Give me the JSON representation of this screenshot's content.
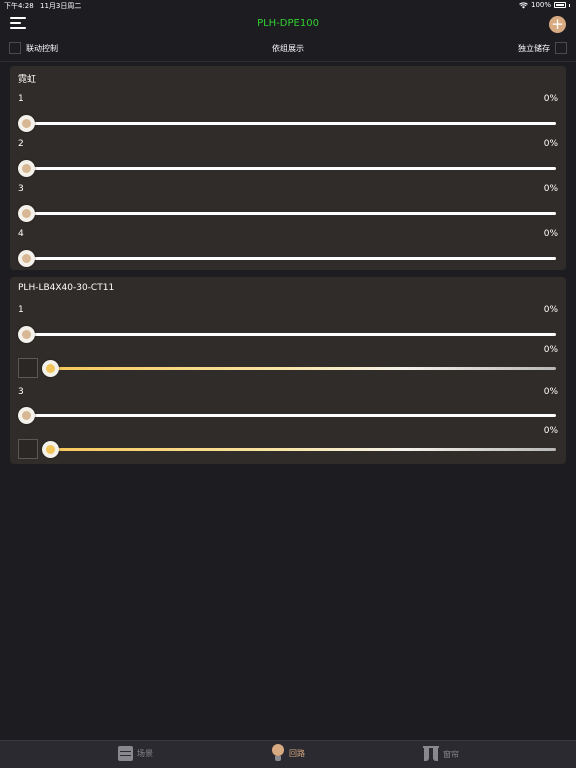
{
  "status": {
    "time": "下午4:28",
    "date": "11月3日周二",
    "battery": "100%",
    "icons": [
      "wifi-icon",
      "battery-icon"
    ]
  },
  "nav": {
    "title": "PLH-DPE100",
    "title_color": "#2fd22f",
    "add_symbol": "+",
    "icons": [
      "menu-icon",
      "add-icon"
    ]
  },
  "options": {
    "linked_control": "联动控制",
    "group_display": "依组展示",
    "independent_storage": "独立储存"
  },
  "groups": [
    {
      "title": "霓虹",
      "channels": [
        {
          "label": "1",
          "percent": "0%",
          "level": 0
        },
        {
          "label": "2",
          "percent": "0%",
          "level": 0
        },
        {
          "label": "3",
          "percent": "0%",
          "level": 0
        },
        {
          "label": "4",
          "percent": "0%",
          "level": 0
        }
      ]
    },
    {
      "title": "PLH-LB4X40-30-CT11",
      "channels": [
        {
          "label": "1",
          "percent": "0%",
          "level": 0
        },
        {
          "label": "",
          "percent": "0%",
          "level": 0,
          "type": "color-temperature"
        },
        {
          "label": "3",
          "percent": "0%",
          "level": 0
        },
        {
          "label": "",
          "percent": "0%",
          "level": 0,
          "type": "color-temperature"
        }
      ]
    }
  ],
  "tabs": [
    {
      "label": "场景",
      "icon": "scene-icon",
      "active": false
    },
    {
      "label": "回路",
      "icon": "bulb-icon",
      "active": true
    },
    {
      "label": "窗帘",
      "icon": "curtain-icon",
      "active": false
    }
  ],
  "colors": {
    "background": "#1c1c21",
    "card": "#302c2a",
    "accent": "#d8aa82",
    "tab_inactive": "#8a8a90"
  }
}
